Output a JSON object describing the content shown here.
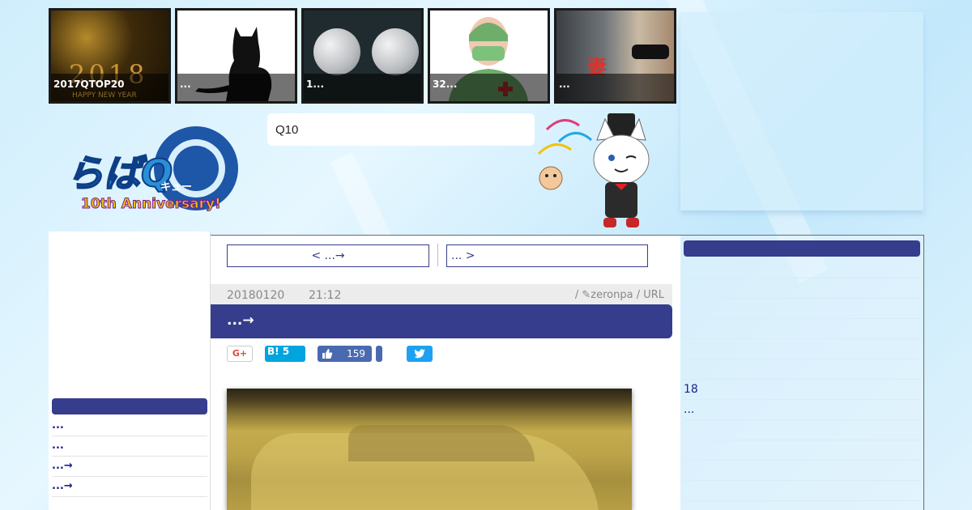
{
  "thumbnails": [
    {
      "caption": "2017QTOP20",
      "overlay_text": "2018",
      "overlay_subtext": "HAPPY NEW YEAR"
    },
    {
      "caption": "..."
    },
    {
      "caption": "1..."
    },
    {
      "caption": "32..."
    },
    {
      "caption": "...",
      "overlay_text": "妻"
    }
  ],
  "header": {
    "logo_text": "らばQ",
    "logo_sub": "キュー",
    "logo_anniv": "10th Anniversary!",
    "search_value": "Q10"
  },
  "left_sidebar": {
    "items": [
      "...",
      "...",
      "...→",
      "...→"
    ]
  },
  "article": {
    "nav_prev": "< ...→",
    "nav_next": "... >",
    "date": "20180120",
    "time": "21:12",
    "author": "/ ✎zeronpa / URL",
    "title": "...→",
    "share": {
      "gplus": "G+",
      "hatena": "B! 5",
      "fb_count": "159"
    }
  },
  "right_sidebar": {
    "items": [
      "",
      "",
      "",
      "",
      "",
      "",
      "18",
      "...",
      "",
      "",
      "",
      ""
    ]
  },
  "colors": {
    "accent": "#353d8c",
    "background": "#cfeefc",
    "link": "#1a238a"
  }
}
